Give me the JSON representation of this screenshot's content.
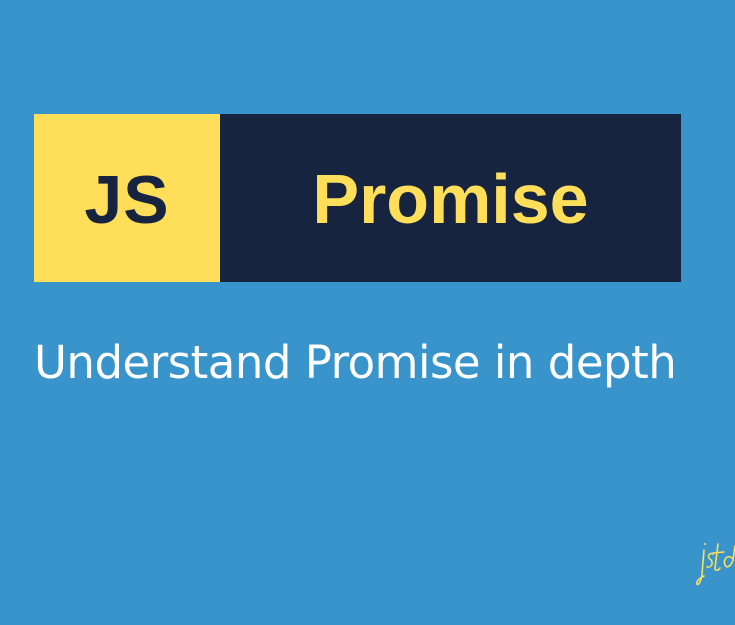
{
  "banner": {
    "badge_label": "JS",
    "title": "Promise"
  },
  "subtitle": "Understand Promise in depth",
  "signature": {
    "text": "jstd"
  },
  "colors": {
    "background": "#3894ca",
    "accent_yellow": "#ffde59",
    "dark_navy": "#172440",
    "subtitle_text": "#ffffff"
  }
}
